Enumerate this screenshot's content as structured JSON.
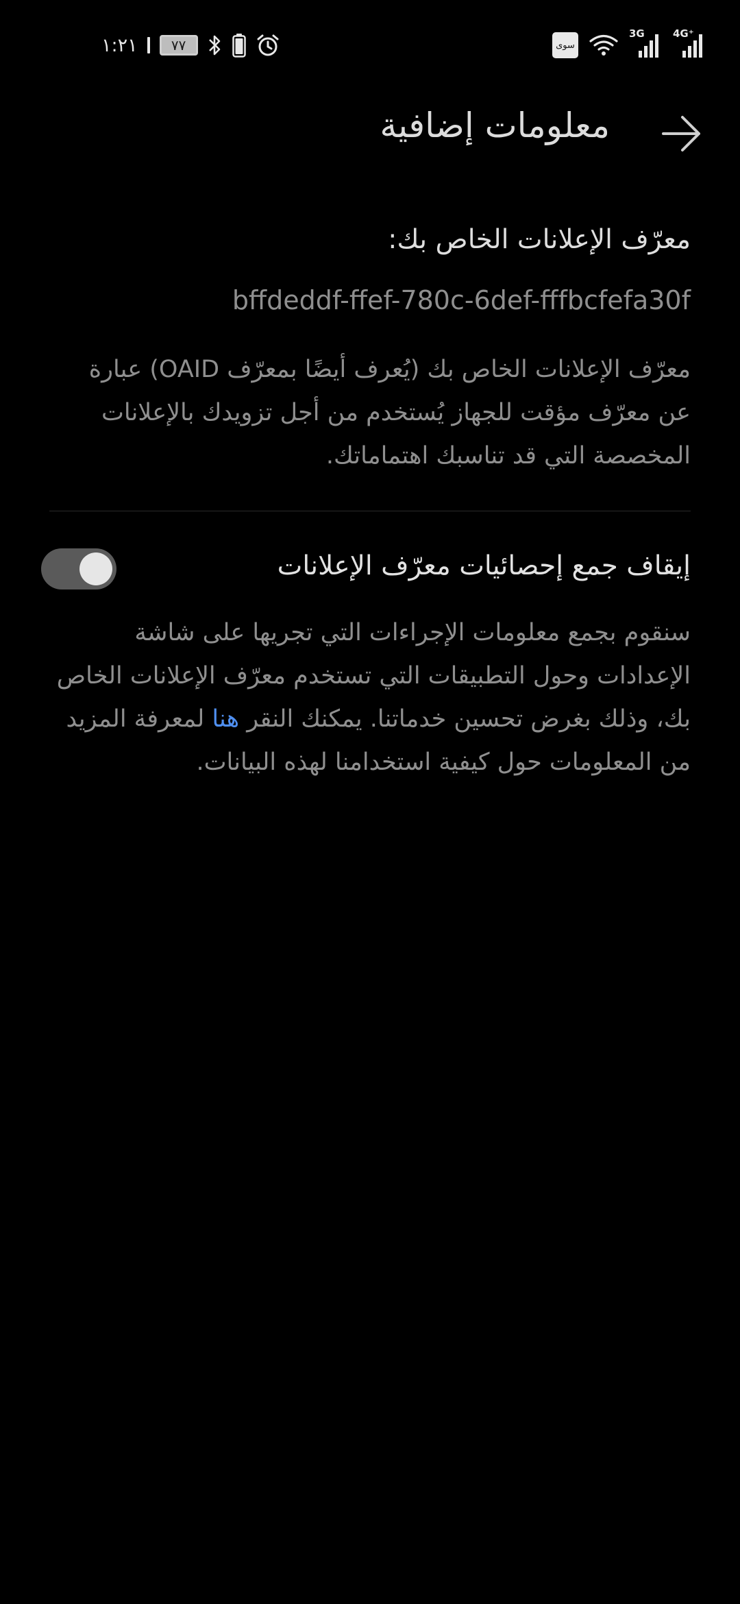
{
  "status_bar": {
    "time": "١:٢١",
    "battery_percent": "٧٧",
    "carrier_badge": "سوى",
    "net_label_1": "3G",
    "net_label_2": "4G⁺",
    "icons": [
      "bluetooth-icon",
      "battery-charging-icon",
      "alarm-icon",
      "wifi-icon",
      "signal-icon"
    ]
  },
  "header": {
    "title": "معلومات إضافية",
    "back_icon": "arrow-back-icon"
  },
  "oaid": {
    "label": "معرّف الإعلانات الخاص بك:",
    "value": "bffdeddf-ffef-780c-6def-fffbcfefa30f",
    "description": "معرّف الإعلانات الخاص بك (يُعرف أيضًا بمعرّف OAID) عبارة عن معرّف مؤقت للجهاز يُستخدم من أجل تزويدك بالإعلانات المخصصة التي قد تناسبك اهتماماتك."
  },
  "stats": {
    "toggle_label": "إيقاف جمع إحصائيات معرّف الإعلانات",
    "toggle_on": true,
    "description_before": "سنقوم بجمع معلومات الإجراءات التي تجريها على شاشة الإعدادات وحول التطبيقات التي تستخدم معرّف الإعلانات الخاص بك، وذلك بغرض تحسين خدماتنا. يمكنك النقر ",
    "link_text": "هنا",
    "description_after": " لمعرفة المزيد من المعلومات حول كيفية استخدامنا لهذه البيانات."
  },
  "colors": {
    "background": "#000000",
    "link": "#4f8ff0",
    "toggle_track": "#5a5a5a",
    "toggle_knob": "#e6e6e6"
  }
}
